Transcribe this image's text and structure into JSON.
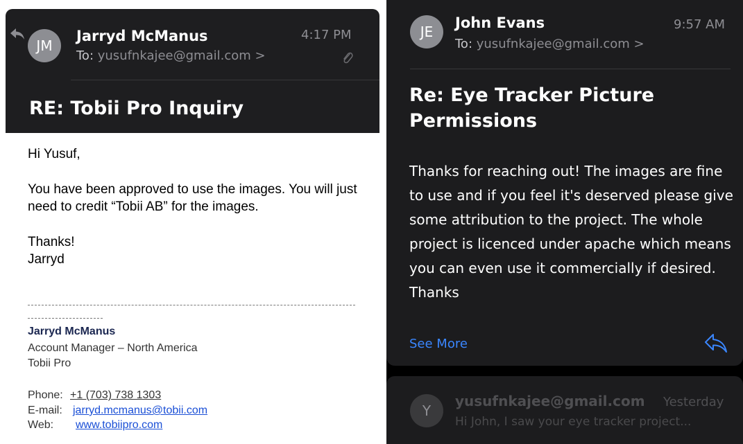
{
  "left_email": {
    "avatar_initials": "JM",
    "sender_name": "Jarryd McManus",
    "to_label": "To:",
    "to_address": "yusufnkajee@gmail.com",
    "to_chevron": ">",
    "time": "4:17 PM",
    "subject": "RE: Tobii Pro Inquiry",
    "body": {
      "greeting": "Hi Yusuf,",
      "paragraph_1": "You have been approved to use the images. You will just need to credit “Tobii AB” for the images.",
      "closing": "Thanks!",
      "sign_name": "Jarryd"
    },
    "signature": {
      "name": "Jarryd McManus",
      "title": "Account Manager – North America",
      "company": "Tobii Pro",
      "phone_label": "Phone:",
      "phone": "+1 (703) 738 1303",
      "email_label": "E-mail:",
      "email": "jarryd.mcmanus@tobii.com",
      "web_label": "Web:",
      "web": "www.tobiipro.com"
    }
  },
  "right_email": {
    "avatar_initials": "JE",
    "sender_name": "John Evans",
    "to_label": "To:",
    "to_address": "yusufnkajee@gmail.com",
    "to_chevron": ">",
    "time": "9:57 AM",
    "subject": "Re: Eye Tracker Picture Permissions",
    "body": "Thanks for reaching out! The images are fine to use and if you feel it's deserved please give some attribution to the project. The whole project is licenced under apache which means you can even use it commercially if desired. Thanks",
    "see_more": "See More"
  },
  "collapsed_email": {
    "avatar_initials": "Y",
    "sender": "yusufnkajee@gmail.com",
    "time": "Yesterday",
    "preview": "Hi John, I saw your eye tracker project..."
  },
  "colors": {
    "accent_blue": "#3a86ff",
    "link_blue": "#1a4fd6",
    "signature_name_navy": "#1a2650",
    "dark_card": "#1c1c1e"
  }
}
